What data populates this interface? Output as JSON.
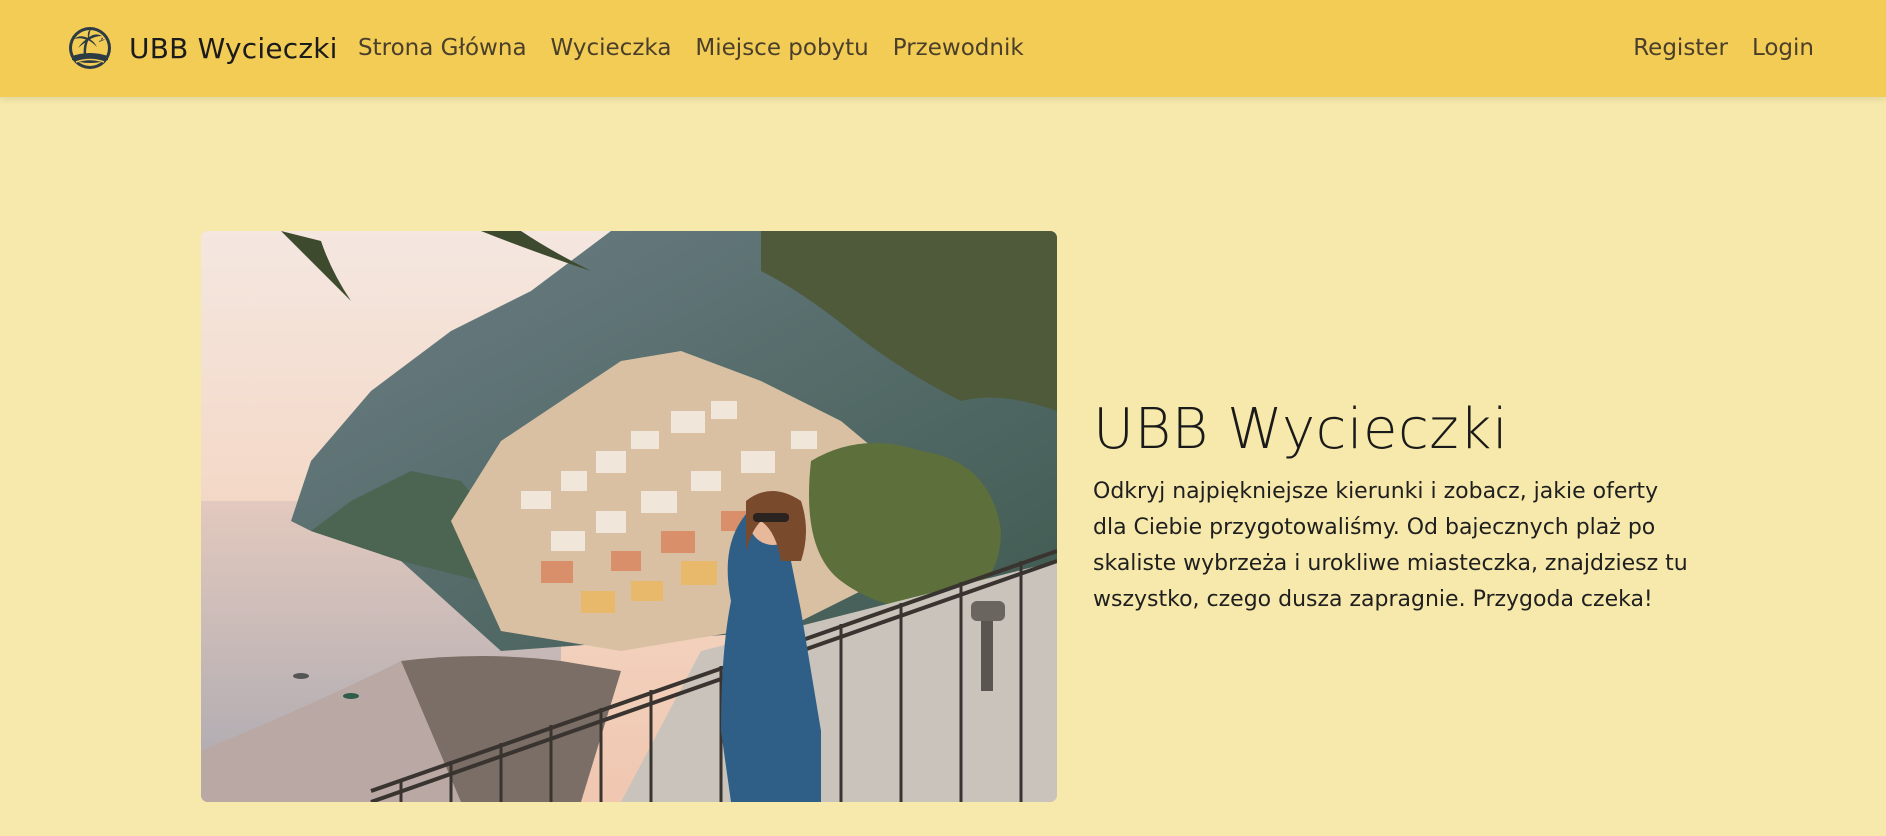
{
  "navbar": {
    "brand_name": "UBB Wycieczki",
    "logo_icon": "palm-beach-logo-icon",
    "links": [
      {
        "label": "Strona Główna"
      },
      {
        "label": "Wycieczka"
      },
      {
        "label": "Miejsce pobytu"
      },
      {
        "label": "Przewodnik"
      }
    ],
    "auth": {
      "register": "Register",
      "login": "Login"
    }
  },
  "hero": {
    "title": "UBB Wycieczki",
    "description": "Odkryj najpiękniejsze kierunki i zobacz, jakie oferty dla Ciebie przygotowaliśmy. Od bajecznych plaż po skaliste wybrzeża i urokliwe miasteczka, znajdziesz tu wszystko, czego dusza zapragnie. Przygoda czeka!"
  },
  "colors": {
    "navbar_bg": "#f3cc55",
    "page_bg": "#f6e9ab"
  }
}
